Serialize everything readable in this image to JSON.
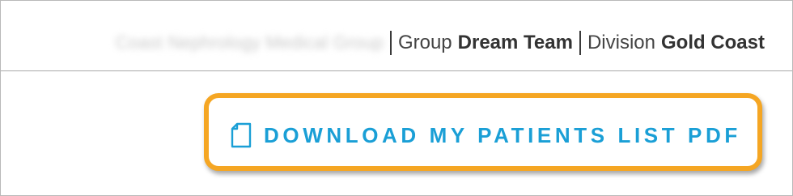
{
  "header": {
    "org_name": "Coast Nephrology Medical Group",
    "group_label": "Group",
    "group_value": "Dream Team",
    "division_label": "Division",
    "division_value": "Gold Coast"
  },
  "actions": {
    "download_label": "DOWNLOAD MY PATIENTS LIST PDF",
    "download_icon": "document-icon"
  },
  "colors": {
    "accent": "#1a9fd6",
    "highlight": "#f5a623"
  }
}
